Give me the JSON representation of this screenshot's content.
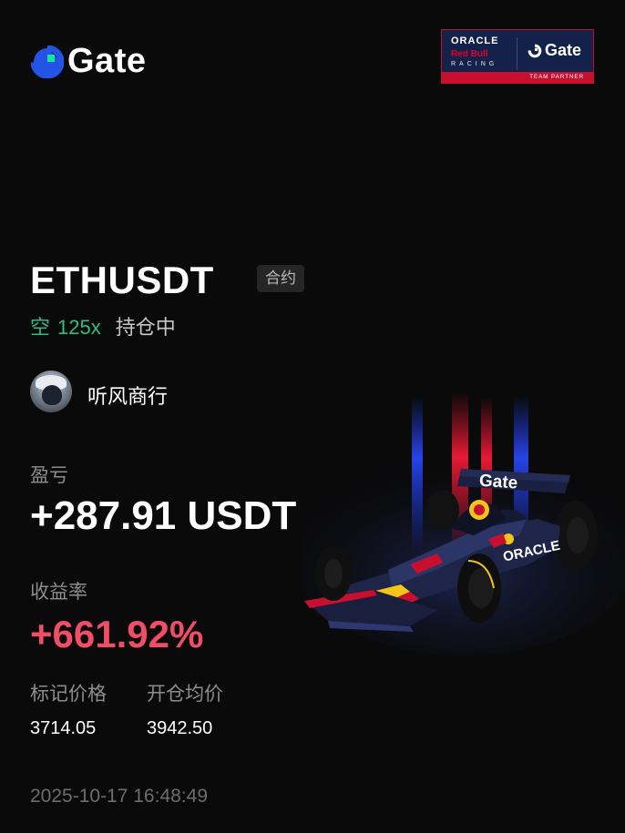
{
  "brand": {
    "name": "Gate"
  },
  "partner": {
    "oracle": "ORACLE",
    "redbull": "Red Bull",
    "racing": "RACING",
    "gate": "Gate",
    "team_partner": "TEAM PARTNER"
  },
  "position": {
    "symbol": "ETHUSDT",
    "contract_tag": "合约",
    "direction": "空",
    "leverage": "125x",
    "status": "持仓中"
  },
  "user": {
    "name": "听风商行"
  },
  "stats": {
    "pnl_label": "盈亏",
    "pnl_value": "+287.91 USDT",
    "roi_label": "收益率",
    "roi_value": "+661.92%",
    "mark_price_label": "标记价格",
    "mark_price_value": "3714.05",
    "entry_price_label": "开仓均价",
    "entry_price_value": "3942.50"
  },
  "timestamp": "2025-10-17 16:48:49",
  "car_livery": {
    "gate": "Gate",
    "oracle": "ORACLE"
  },
  "colors": {
    "background": "#0a0a0b",
    "short_green": "#2fbd85",
    "roi_red": "#f04e66",
    "muted_text": "#8d8d8d",
    "gate_blue": "#2354e6",
    "gate_green": "#17e6a1"
  }
}
